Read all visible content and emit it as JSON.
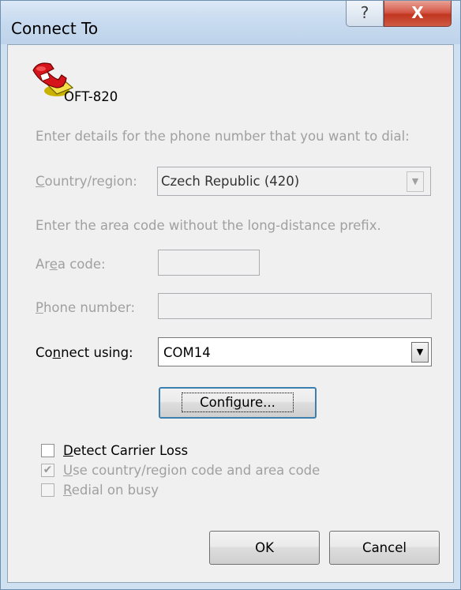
{
  "window": {
    "title": "Connect To"
  },
  "titlebar": {
    "help_glyph": "?",
    "close_glyph": "X"
  },
  "connection": {
    "name": "OFT-820"
  },
  "intro_text": "Enter details for the phone number that you want to dial:",
  "country": {
    "label_pre": "",
    "label_key": "C",
    "label_post": "ountry/region:",
    "value": "Czech Republic (420)"
  },
  "area_hint": "Enter the area code without the long-distance prefix.",
  "area_code": {
    "label_pre": "Ar",
    "label_key": "e",
    "label_post": "a code:",
    "value": ""
  },
  "phone_number": {
    "label_pre": "",
    "label_key": "P",
    "label_post": "hone number:",
    "value": ""
  },
  "connect_using": {
    "label_pre": "Co",
    "label_key": "n",
    "label_post": "nect using:",
    "value": "COM14"
  },
  "configure_button": {
    "label_pre": "Confi",
    "label_key": "g",
    "label_post": "ure..."
  },
  "options": {
    "detect_carrier": {
      "pre": "",
      "key": "D",
      "post": "etect Carrier Loss",
      "checked": false
    },
    "use_country_code": {
      "pre": "",
      "key": "U",
      "post": "se country/region code and area code",
      "checked": true
    },
    "redial": {
      "pre": "",
      "key": "R",
      "post": "edial on busy",
      "checked": false
    }
  },
  "ok_button": "OK",
  "cancel_button": "Cancel",
  "icons": {
    "phone": "telephone-icon",
    "dropdown": "chevron-down-icon"
  }
}
